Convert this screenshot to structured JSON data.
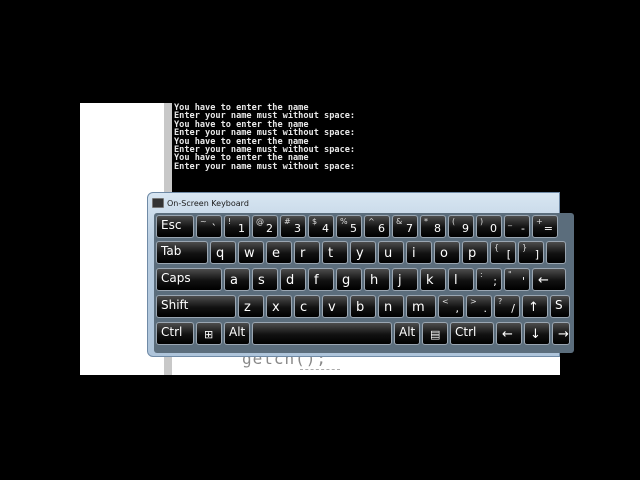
{
  "console": {
    "lines": [
      "You have to enter the name",
      "Enter your name must without space:",
      "You have to enter the name",
      "Enter your name must without space:",
      "You have to enter the name",
      "Enter your name must without space:",
      "You have to enter the name",
      "Enter your name must without space:"
    ]
  },
  "editor": {
    "code": "getch();"
  },
  "osk": {
    "title": "On-Screen Keyboard",
    "row1": {
      "esc": "Esc",
      "keys": [
        {
          "sym": "~",
          "sym2": "`",
          "num": ""
        },
        {
          "sym": "!",
          "num": "1"
        },
        {
          "sym": "@",
          "num": "2"
        },
        {
          "sym": "#",
          "num": "3"
        },
        {
          "sym": "$",
          "num": "4"
        },
        {
          "sym": "%",
          "num": "5"
        },
        {
          "sym": "^",
          "num": "6"
        },
        {
          "sym": "&",
          "num": "7"
        },
        {
          "sym": "*",
          "num": "8"
        },
        {
          "sym": "(",
          "num": "9"
        },
        {
          "sym": ")",
          "num": "0"
        },
        {
          "sym": "_",
          "num": "-"
        },
        {
          "sym": "+",
          "num": "="
        }
      ]
    },
    "row2": {
      "tab": "Tab",
      "keys": [
        "q",
        "w",
        "e",
        "r",
        "t",
        "y",
        "u",
        "i",
        "o",
        "p"
      ],
      "brackets": [
        {
          "sym": "{",
          "num": "["
        },
        {
          "sym": "}",
          "num": "]"
        }
      ]
    },
    "row3": {
      "caps": "Caps",
      "keys": [
        "a",
        "s",
        "d",
        "f",
        "g",
        "h",
        "j",
        "k",
        "l"
      ],
      "punct": [
        {
          "sym": ":",
          "num": ";"
        },
        {
          "sym": "\"",
          "num": "'"
        }
      ],
      "enter": "←"
    },
    "row4": {
      "shift": "Shift",
      "keys": [
        "z",
        "x",
        "c",
        "v",
        "b",
        "n",
        "m"
      ],
      "punct": [
        {
          "sym": "<",
          "num": ","
        },
        {
          "sym": ">",
          "num": "."
        },
        {
          "sym": "?",
          "num": "/"
        }
      ],
      "up": "↑",
      "rshift": "S"
    },
    "row5": {
      "ctrl": "Ctrl",
      "win": "⊞",
      "alt": "Alt",
      "altgr": "Alt",
      "menu": "▤",
      "rctrl": "Ctrl",
      "left": "←",
      "down": "↓",
      "right": "→"
    }
  }
}
